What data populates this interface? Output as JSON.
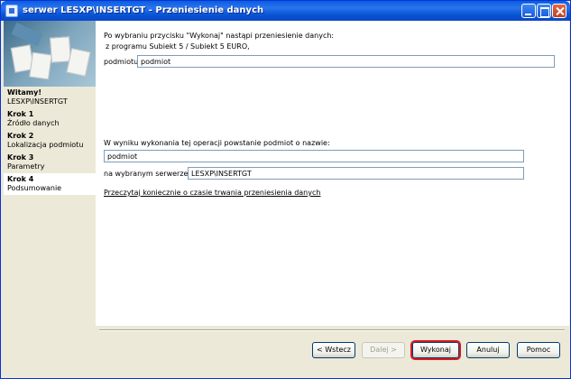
{
  "window": {
    "title": "serwer LESXP\\INSERTGT - Przeniesienie danych"
  },
  "sidebar": {
    "steps": [
      {
        "title": "Witamy!",
        "desc": "LESXP\\INSERTGT"
      },
      {
        "title": "Krok 1",
        "desc": "Źródło danych"
      },
      {
        "title": "Krok 2",
        "desc": "Lokalizacja podmiotu"
      },
      {
        "title": "Krok 3",
        "desc": "Parametry"
      },
      {
        "title": "Krok 4",
        "desc": "Podsumowanie"
      }
    ],
    "active_step": 4
  },
  "main": {
    "intro_line1": "Po wybraniu przycisku \"Wykonaj\" nastąpi przeniesienie danych:",
    "intro_line2": "z programu Subiekt 5 / Subiekt 5 EURO,",
    "subject_label": "podmiotu:",
    "subject_value": "podmiot",
    "result_line": "W wyniku wykonania tej operacji powstanie podmiot o nazwie:",
    "new_subject_value": "podmiot",
    "server_label": "na wybranym serwerze:",
    "server_value": "LESXP\\INSERTGT",
    "info_link": "Przeczytaj koniecznie o czasie trwania przeniesienia danych"
  },
  "buttons": {
    "back": "< Wstecz",
    "next": "Dalej >",
    "execute": "Wykonaj",
    "cancel": "Anuluj",
    "help": "Pomoc"
  },
  "colors": {
    "title_bar": "#0a5ee0",
    "highlight": "#d9171e"
  }
}
